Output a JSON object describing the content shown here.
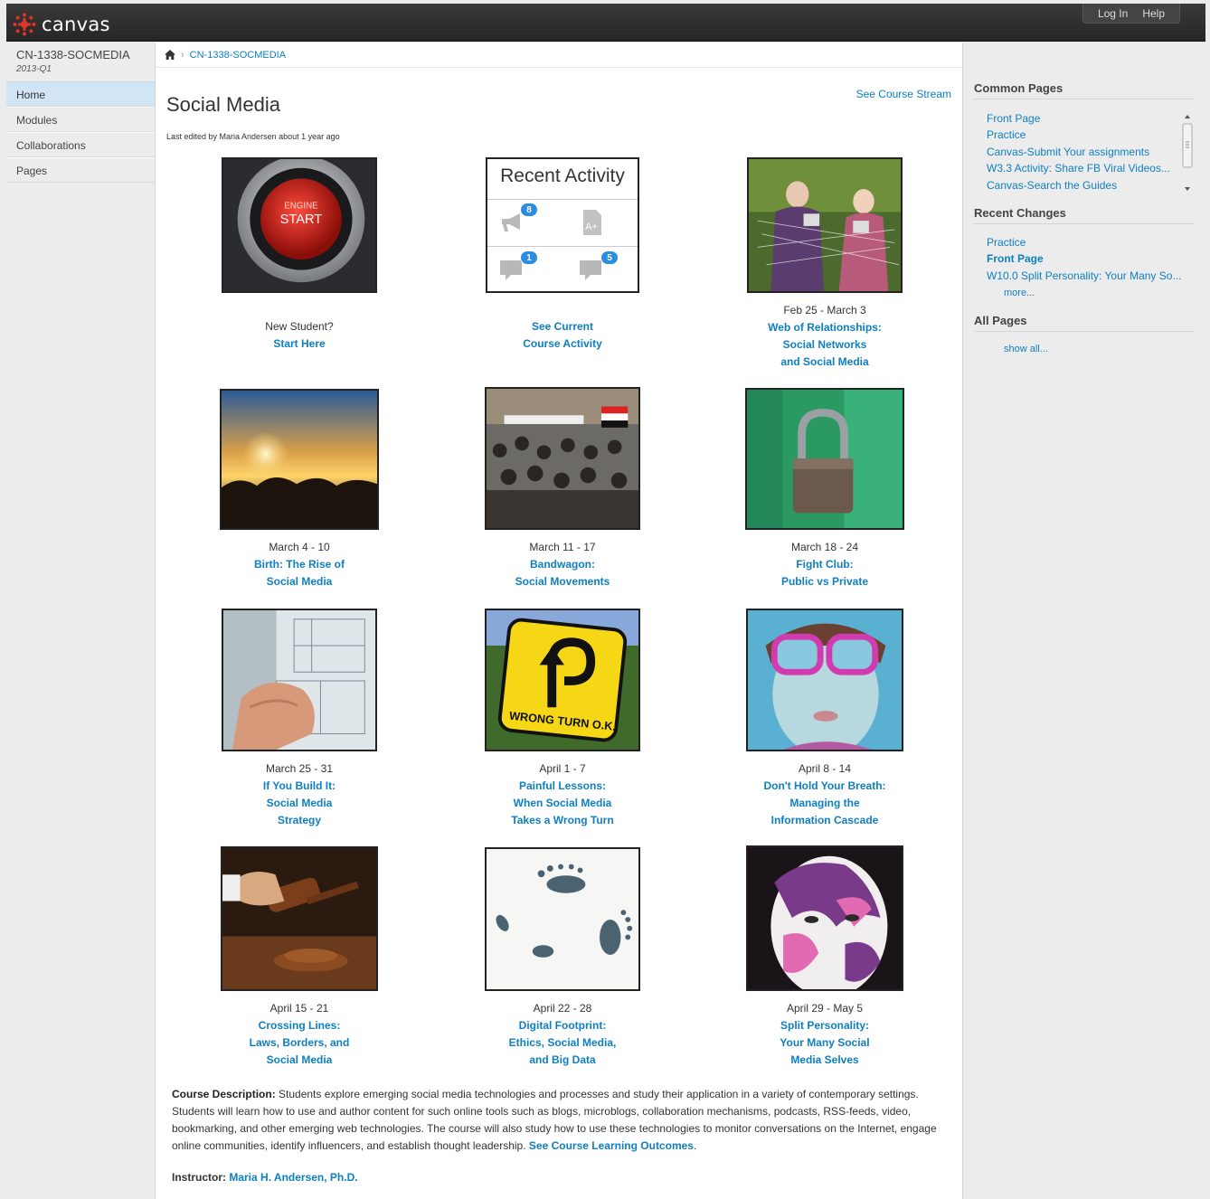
{
  "header": {
    "logo_text": "canvas",
    "login_label": "Log In",
    "help_label": "Help"
  },
  "nav": {
    "course_code": "CN-1338-SOCMEDIA",
    "term": "2013-Q1",
    "items": [
      "Home",
      "Modules",
      "Collaborations",
      "Pages"
    ]
  },
  "breadcrumb": {
    "course": "CN-1338-SOCMEDIA"
  },
  "page": {
    "title": "Social Media",
    "stream_link": "See Course Stream",
    "last_edited": "Last edited by Maria Andersen about 1 year ago"
  },
  "tiles": {
    "t0": {
      "plain": "New Student?",
      "link": "Start Here"
    },
    "t1": {
      "ra_title": "Recent Activity",
      "badges": [
        "8",
        "1",
        "5"
      ],
      "lines": [
        "See Current",
        "Course Activity"
      ]
    },
    "t2": {
      "date": "Feb 25 - March 3",
      "lines": [
        "Web of Relationships:",
        "Social Networks",
        "and Social Media"
      ]
    },
    "t3": {
      "date": "March 4 - 10",
      "lines": [
        "Birth: The Rise of",
        "Social Media"
      ]
    },
    "t4": {
      "date": "March 11 - 17",
      "lines": [
        "Bandwagon:",
        "Social Movements"
      ]
    },
    "t5": {
      "date": "March 18 - 24",
      "lines": [
        "Fight Club:",
        "Public vs Private"
      ]
    },
    "t6": {
      "date": "March 25 - 31",
      "lines": [
        "If You Build It:",
        "Social Media",
        "Strategy"
      ]
    },
    "t7": {
      "date": "April 1 - 7",
      "lines": [
        "Painful Lessons:",
        "When Social Media",
        "Takes a Wrong Turn"
      ],
      "sign_text": "WRONG TURN O.K."
    },
    "t8": {
      "date": "April 8 - 14",
      "lines": [
        "Don't Hold Your Breath:",
        "Managing the",
        "Information Cascade"
      ]
    },
    "t9": {
      "date": "April 15 - 21",
      "lines": [
        "Crossing Lines:",
        "Laws, Borders, and",
        "Social Media"
      ]
    },
    "t10": {
      "date": "April 22 - 28",
      "lines": [
        "Digital Footprint:",
        "Ethics, Social Media,",
        "and Big Data"
      ]
    },
    "t11": {
      "date": "April 29 - May 5",
      "lines": [
        "Split Personality:",
        "Your Many Social",
        "Media Selves"
      ]
    }
  },
  "engine_button": {
    "line1": "ENGINE",
    "line2": "START"
  },
  "description": {
    "label": "Course Description:",
    "text": " Students explore emerging social media technologies and processes and study their application in a variety of contemporary settings. Students will learn how to use and author content for such online tools such as blogs, microblogs, collaboration mechanisms, podcasts, RSS-feeds, video, bookmarking, and other emerging web technologies. The course will also study how to use these technologies to monitor conversations on the Internet, engage online communities, identify influencers, and establish thought leadership. ",
    "link": "See Course Learning Outcomes",
    "after": "."
  },
  "instructor": {
    "label": "Instructor:",
    "name": "Maria H. Andersen, Ph.D."
  },
  "sidebar": {
    "common_title": "Common Pages",
    "common_links": [
      "Front Page",
      "Practice",
      "Canvas-Submit Your assignments",
      "W3.3 Activity: Share FB Viral Videos...",
      "Canvas-Search the Guides"
    ],
    "recent_title": "Recent Changes",
    "recent_links": [
      "Practice",
      "Front Page",
      "W10.0 Split Personality: Your Many So..."
    ],
    "more_label": "more...",
    "all_title": "All Pages",
    "show_all_label": "show all..."
  },
  "colors": {
    "link": "#0e7fc1",
    "header_bg": "#2d2d2d",
    "nav_active": "#d2e5f5",
    "badge": "#2a8de0",
    "logo": "#e4332b"
  }
}
